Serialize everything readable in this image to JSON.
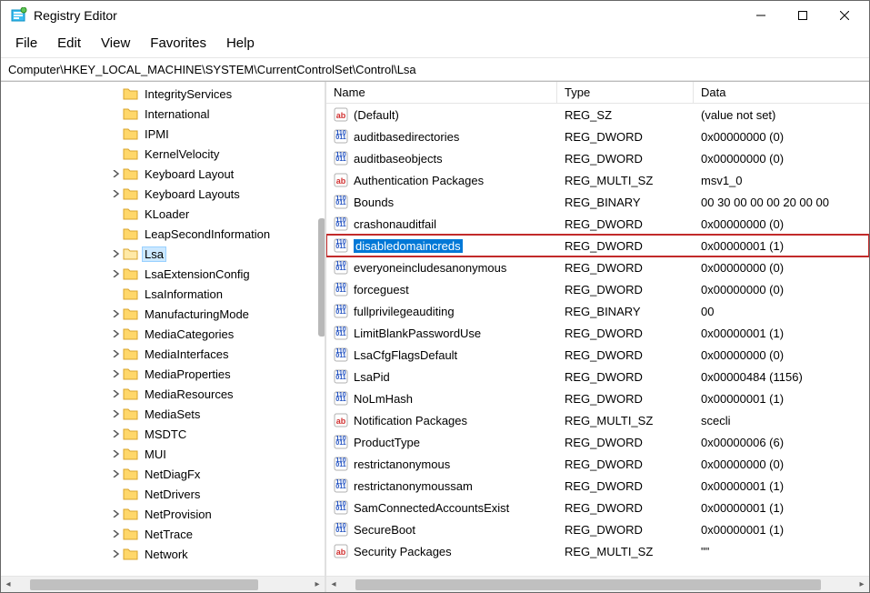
{
  "window": {
    "title": "Registry Editor"
  },
  "menu": {
    "file": "File",
    "edit": "Edit",
    "view": "View",
    "favorites": "Favorites",
    "help": "Help"
  },
  "address": "Computer\\HKEY_LOCAL_MACHINE\\SYSTEM\\CurrentControlSet\\Control\\Lsa",
  "columns": {
    "name": "Name",
    "type": "Type",
    "data": "Data"
  },
  "tree": [
    {
      "label": "IntegrityServices",
      "indent": 120,
      "chev": ""
    },
    {
      "label": "International",
      "indent": 120,
      "chev": ""
    },
    {
      "label": "IPMI",
      "indent": 120,
      "chev": ""
    },
    {
      "label": "KernelVelocity",
      "indent": 120,
      "chev": ""
    },
    {
      "label": "Keyboard Layout",
      "indent": 120,
      "chev": ">"
    },
    {
      "label": "Keyboard Layouts",
      "indent": 120,
      "chev": ">"
    },
    {
      "label": "KLoader",
      "indent": 120,
      "chev": ""
    },
    {
      "label": "LeapSecondInformation",
      "indent": 120,
      "chev": ""
    },
    {
      "label": "Lsa",
      "indent": 120,
      "chev": ">",
      "selected": true
    },
    {
      "label": "LsaExtensionConfig",
      "indent": 120,
      "chev": ">"
    },
    {
      "label": "LsaInformation",
      "indent": 120,
      "chev": ""
    },
    {
      "label": "ManufacturingMode",
      "indent": 120,
      "chev": ">"
    },
    {
      "label": "MediaCategories",
      "indent": 120,
      "chev": ">"
    },
    {
      "label": "MediaInterfaces",
      "indent": 120,
      "chev": ">"
    },
    {
      "label": "MediaProperties",
      "indent": 120,
      "chev": ">"
    },
    {
      "label": "MediaResources",
      "indent": 120,
      "chev": ">"
    },
    {
      "label": "MediaSets",
      "indent": 120,
      "chev": ">"
    },
    {
      "label": "MSDTC",
      "indent": 120,
      "chev": ">"
    },
    {
      "label": "MUI",
      "indent": 120,
      "chev": ">"
    },
    {
      "label": "NetDiagFx",
      "indent": 120,
      "chev": ">"
    },
    {
      "label": "NetDrivers",
      "indent": 120,
      "chev": ""
    },
    {
      "label": "NetProvision",
      "indent": 120,
      "chev": ">"
    },
    {
      "label": "NetTrace",
      "indent": 120,
      "chev": ">"
    },
    {
      "label": "Network",
      "indent": 120,
      "chev": ">"
    }
  ],
  "values": [
    {
      "name": "(Default)",
      "type": "REG_SZ",
      "data": "(value not set)",
      "icon": "str"
    },
    {
      "name": "auditbasedirectories",
      "type": "REG_DWORD",
      "data": "0x00000000 (0)",
      "icon": "bin"
    },
    {
      "name": "auditbaseobjects",
      "type": "REG_DWORD",
      "data": "0x00000000 (0)",
      "icon": "bin"
    },
    {
      "name": "Authentication Packages",
      "type": "REG_MULTI_SZ",
      "data": "msv1_0",
      "icon": "str"
    },
    {
      "name": "Bounds",
      "type": "REG_BINARY",
      "data": "00 30 00 00 00 20 00 00",
      "icon": "bin"
    },
    {
      "name": "crashonauditfail",
      "type": "REG_DWORD",
      "data": "0x00000000 (0)",
      "icon": "bin"
    },
    {
      "name": "disabledomaincreds",
      "type": "REG_DWORD",
      "data": "0x00000001 (1)",
      "icon": "bin",
      "selected": true
    },
    {
      "name": "everyoneincludesanonymous",
      "type": "REG_DWORD",
      "data": "0x00000000 (0)",
      "icon": "bin"
    },
    {
      "name": "forceguest",
      "type": "REG_DWORD",
      "data": "0x00000000 (0)",
      "icon": "bin"
    },
    {
      "name": "fullprivilegeauditing",
      "type": "REG_BINARY",
      "data": "00",
      "icon": "bin"
    },
    {
      "name": "LimitBlankPasswordUse",
      "type": "REG_DWORD",
      "data": "0x00000001 (1)",
      "icon": "bin"
    },
    {
      "name": "LsaCfgFlagsDefault",
      "type": "REG_DWORD",
      "data": "0x00000000 (0)",
      "icon": "bin"
    },
    {
      "name": "LsaPid",
      "type": "REG_DWORD",
      "data": "0x00000484 (1156)",
      "icon": "bin"
    },
    {
      "name": "NoLmHash",
      "type": "REG_DWORD",
      "data": "0x00000001 (1)",
      "icon": "bin"
    },
    {
      "name": "Notification Packages",
      "type": "REG_MULTI_SZ",
      "data": "scecli",
      "icon": "str"
    },
    {
      "name": "ProductType",
      "type": "REG_DWORD",
      "data": "0x00000006 (6)",
      "icon": "bin"
    },
    {
      "name": "restrictanonymous",
      "type": "REG_DWORD",
      "data": "0x00000000 (0)",
      "icon": "bin"
    },
    {
      "name": "restrictanonymoussam",
      "type": "REG_DWORD",
      "data": "0x00000001 (1)",
      "icon": "bin"
    },
    {
      "name": "SamConnectedAccountsExist",
      "type": "REG_DWORD",
      "data": "0x00000001 (1)",
      "icon": "bin"
    },
    {
      "name": "SecureBoot",
      "type": "REG_DWORD",
      "data": "0x00000001 (1)",
      "icon": "bin"
    },
    {
      "name": "Security Packages",
      "type": "REG_MULTI_SZ",
      "data": "\"\"",
      "icon": "str"
    }
  ]
}
